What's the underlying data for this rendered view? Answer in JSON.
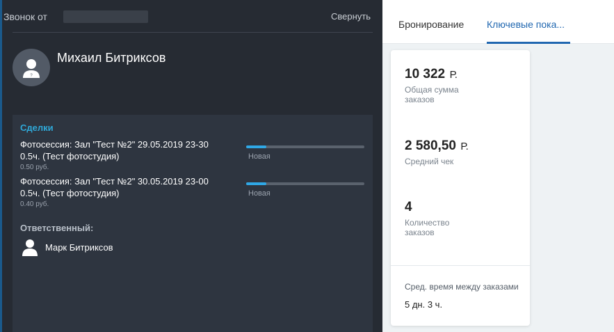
{
  "call_panel": {
    "title": "Звонок от",
    "collapse_label": "Свернуть",
    "contact_name": "Михаил Битриксов",
    "deals": {
      "title": "Сделки",
      "items": [
        {
          "name": "Фотосессия: Зал \"Тест №2\" 29.05.2019 23-30 0.5ч. (Тест фотостудия)",
          "price": "0.50 руб.",
          "stage": "Новая",
          "progress": 0.17
        },
        {
          "name": "Фотосессия: Зал \"Тест №2\" 30.05.2019 23-00 0.5ч. (Тест фотостудия)",
          "price": "0.40 руб.",
          "stage": "Новая",
          "progress": 0.17
        }
      ]
    },
    "responsible": {
      "title": "Ответственный:",
      "name": "Марк Битриксов"
    }
  },
  "tabs": {
    "booking": "Бронирование",
    "kpi": "Ключевые пока..."
  },
  "kpi": {
    "total": {
      "value": "10 322",
      "unit": "Р.",
      "label": "Общая сумма заказов"
    },
    "average": {
      "value": "2 580,50",
      "unit": "Р.",
      "label": "Средний чек"
    },
    "count": {
      "value": "4",
      "label": "Количество заказов"
    },
    "avg_time": {
      "label": "Сред. время между заказами",
      "value": "5 дн. 3 ч."
    }
  },
  "colors": {
    "panel_bg": "#262b33",
    "accent": "#2fa8d8",
    "tab_active": "#2067b0"
  }
}
